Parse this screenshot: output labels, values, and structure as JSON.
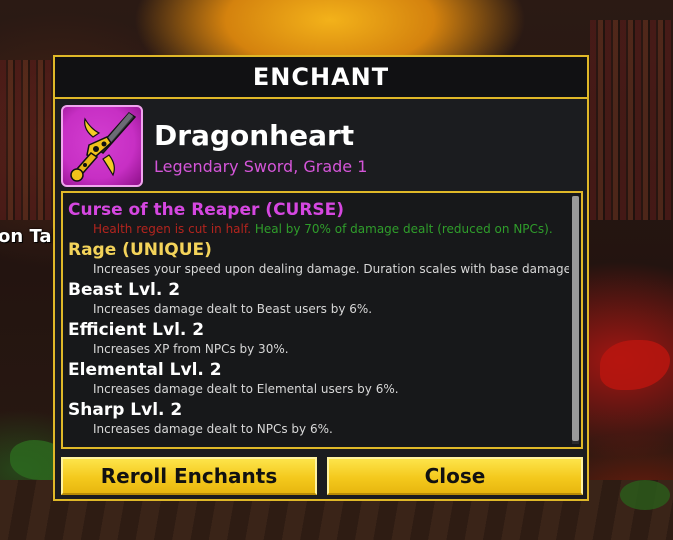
{
  "world": {
    "side_label": "on Tal"
  },
  "panel": {
    "title": "ENCHANT",
    "item": {
      "name": "Dragonheart",
      "subtitle": "Legendary Sword, Grade 1",
      "icon": "dragonheart-sword-icon",
      "rarity_color": "#c72fc4"
    },
    "enchants": [
      {
        "name": "Curse of the Reaper (CURSE)",
        "name_color": "#d547e0",
        "desc_parts": [
          {
            "text": "Health regen is cut in half.",
            "color": "#b3241e"
          },
          {
            "text": " Heal by 70% of damage dealt (reduced on NPCs).",
            "color": "#2f9d2b"
          }
        ]
      },
      {
        "name": "Rage (UNIQUE)",
        "name_color": "#f3d35a",
        "desc": "Increases your speed upon dealing damage. Duration scales with base damage."
      },
      {
        "name": "Beast Lvl. 2",
        "name_color": "#ffffff",
        "desc": "Increases damage dealt to Beast users by 6%."
      },
      {
        "name": "Efficient Lvl. 2",
        "name_color": "#ffffff",
        "desc": "Increases XP from NPCs by 30%."
      },
      {
        "name": "Elemental Lvl. 2",
        "name_color": "#ffffff",
        "desc": "Increases damage dealt to Elemental users by 6%."
      },
      {
        "name": "Sharp Lvl. 2",
        "name_color": "#ffffff",
        "desc": "Increases damage dealt to NPCs by 6%."
      }
    ],
    "buttons": {
      "reroll_label": "Reroll Enchants",
      "close_label": "Close"
    },
    "accent_color": "#e0b828"
  }
}
